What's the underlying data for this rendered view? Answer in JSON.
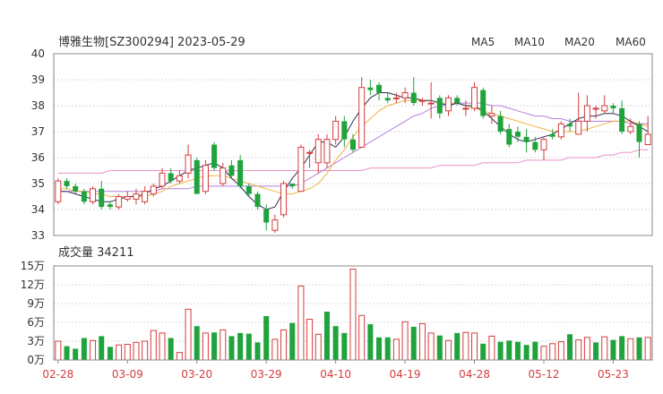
{
  "header": {
    "title": "博雅生物[SZ300294] 2023-05-29"
  },
  "legend": [
    {
      "label": "MA5",
      "color": "#2b2d57"
    },
    {
      "label": "MA10",
      "color": "#f2b142"
    },
    {
      "label": "MA20",
      "color": "#b67ee0"
    },
    {
      "label": "MA60",
      "color": "#ee8fc6"
    }
  ],
  "volume_header": {
    "label": "成交量 34211"
  },
  "colors": {
    "up": "#d43c3c",
    "down": "#1fa33b",
    "grid": "#d9d9d9",
    "frame": "#888888"
  },
  "chart_data": [
    {
      "type": "candlestick",
      "ylim": [
        33,
        40
      ],
      "yticks": [
        "40",
        "39",
        "38",
        "37",
        "36",
        "35",
        "34",
        "33"
      ],
      "xlabels": [
        "02-28",
        "03-09",
        "03-20",
        "03-29",
        "04-10",
        "04-19",
        "04-28",
        "05-12",
        "05-23"
      ],
      "xlabel_index": [
        0,
        8,
        16,
        24,
        32,
        40,
        48,
        56,
        64
      ],
      "candles": [
        [
          34.3,
          35.1,
          35.2,
          34.2
        ],
        [
          35.1,
          34.9,
          35.2,
          34.8
        ],
        [
          34.9,
          34.7,
          35.0,
          34.6
        ],
        [
          34.7,
          34.3,
          34.8,
          34.2
        ],
        [
          34.3,
          34.8,
          34.9,
          34.2
        ],
        [
          34.8,
          34.1,
          35.1,
          34.0
        ],
        [
          34.2,
          34.1,
          34.3,
          34.0
        ],
        [
          34.1,
          34.5,
          34.6,
          34.0
        ],
        [
          34.4,
          34.5,
          34.7,
          34.3
        ],
        [
          34.4,
          34.6,
          34.8,
          34.2
        ],
        [
          34.3,
          34.7,
          34.9,
          34.2
        ],
        [
          34.6,
          34.9,
          35.0,
          34.5
        ],
        [
          34.9,
          35.4,
          35.6,
          34.8
        ],
        [
          35.4,
          35.1,
          35.6,
          35.0
        ],
        [
          35.1,
          35.3,
          35.5,
          35.0
        ],
        [
          35.4,
          36.1,
          36.5,
          35.2
        ],
        [
          35.9,
          34.6,
          36.0,
          34.6
        ],
        [
          34.7,
          35.7,
          35.9,
          34.6
        ],
        [
          36.5,
          35.6,
          36.6,
          35.5
        ],
        [
          35.0,
          35.6,
          35.8,
          34.9
        ],
        [
          35.7,
          35.3,
          35.9,
          35.2
        ],
        [
          35.9,
          34.9,
          36.1,
          34.8
        ],
        [
          34.9,
          34.6,
          35.0,
          34.5
        ],
        [
          34.6,
          34.1,
          34.7,
          34.0
        ],
        [
          34.0,
          33.5,
          34.2,
          33.2
        ],
        [
          33.2,
          33.6,
          33.8,
          33.1
        ],
        [
          33.8,
          35.0,
          35.1,
          33.7
        ],
        [
          35.0,
          34.9,
          35.0,
          34.8
        ],
        [
          34.7,
          36.4,
          36.5,
          34.7
        ],
        [
          36.2,
          36.2,
          36.3,
          35.6
        ],
        [
          35.8,
          36.7,
          36.9,
          35.4
        ],
        [
          35.8,
          36.7,
          36.9,
          35.6
        ],
        [
          36.7,
          37.4,
          37.6,
          36.5
        ],
        [
          37.4,
          36.7,
          37.6,
          36.4
        ],
        [
          36.7,
          36.3,
          36.9,
          36.2
        ],
        [
          36.4,
          38.7,
          39.1,
          36.4
        ],
        [
          38.7,
          38.6,
          39.0,
          38.4
        ],
        [
          38.8,
          38.5,
          38.9,
          38.2
        ],
        [
          38.3,
          38.2,
          38.5,
          38.1
        ],
        [
          38.3,
          38.3,
          38.5,
          38.1
        ],
        [
          38.3,
          38.5,
          38.7,
          38.1
        ],
        [
          38.5,
          38.1,
          39.1,
          38.0
        ],
        [
          38.2,
          38.2,
          38.3,
          38.0
        ],
        [
          38.1,
          38.1,
          38.9,
          37.5
        ],
        [
          38.3,
          37.7,
          38.4,
          37.5
        ],
        [
          37.8,
          38.3,
          38.4,
          37.6
        ],
        [
          38.3,
          38.1,
          38.4,
          38.0
        ],
        [
          37.9,
          37.9,
          38.2,
          37.6
        ],
        [
          37.9,
          38.7,
          38.9,
          37.8
        ],
        [
          38.6,
          37.6,
          38.7,
          37.5
        ],
        [
          37.6,
          37.7,
          38.0,
          37.3
        ],
        [
          37.6,
          37.0,
          37.8,
          36.9
        ],
        [
          37.1,
          36.5,
          37.3,
          36.4
        ],
        [
          37.0,
          36.8,
          37.2,
          36.6
        ],
        [
          36.8,
          36.6,
          37.1,
          36.2
        ],
        [
          36.6,
          36.3,
          36.8,
          36.2
        ],
        [
          36.3,
          36.7,
          36.8,
          35.9
        ],
        [
          36.9,
          36.8,
          37.1,
          36.7
        ],
        [
          36.8,
          37.3,
          37.4,
          36.7
        ],
        [
          37.3,
          37.2,
          37.5,
          37.0
        ],
        [
          36.9,
          37.4,
          38.5,
          36.9
        ],
        [
          37.4,
          38.0,
          38.4,
          37.0
        ],
        [
          37.9,
          37.9,
          38.0,
          37.5
        ],
        [
          37.8,
          38.0,
          38.4,
          37.7
        ],
        [
          38.0,
          37.9,
          38.1,
          37.7
        ],
        [
          37.9,
          37.0,
          38.2,
          36.9
        ],
        [
          37.0,
          37.2,
          37.5,
          36.9
        ],
        [
          37.3,
          36.6,
          37.4,
          36.0
        ],
        [
          36.5,
          36.9,
          37.6,
          36.5
        ]
      ],
      "ma5": [
        34.7,
        34.7,
        34.6,
        34.5,
        34.4,
        34.3,
        34.3,
        34.4,
        34.5,
        34.5,
        34.6,
        34.8,
        34.9,
        35.1,
        35.3,
        35.5,
        35.6,
        35.7,
        35.8,
        35.6,
        35.2,
        34.9,
        34.5,
        34.2,
        34.0,
        34.1,
        34.7,
        35.2,
        35.6,
        36.1,
        36.6,
        36.6,
        36.4,
        36.8,
        37.4,
        37.9,
        38.3,
        38.5,
        38.5,
        38.4,
        38.3,
        38.3,
        38.2,
        38.2,
        38.1,
        38.0,
        38.1,
        38.0,
        38.0,
        37.8,
        37.5,
        37.2,
        36.9,
        36.7,
        36.6,
        36.7,
        36.8,
        36.9,
        37.1,
        37.3,
        37.5,
        37.6,
        37.6,
        37.7,
        37.7,
        37.6,
        37.4,
        37.2,
        37.0
      ],
      "ma10": [
        34.8,
        34.8,
        34.7,
        34.7,
        34.6,
        34.6,
        34.5,
        34.5,
        34.5,
        34.5,
        34.5,
        34.6,
        34.7,
        34.9,
        35.0,
        35.1,
        35.2,
        35.3,
        35.3,
        35.3,
        35.2,
        35.1,
        35.0,
        34.9,
        34.8,
        34.7,
        34.6,
        34.6,
        34.7,
        34.8,
        35.0,
        35.4,
        35.9,
        36.3,
        36.8,
        37.2,
        37.5,
        37.8,
        38.0,
        38.1,
        38.2,
        38.2,
        38.2,
        38.2,
        38.1,
        38.1,
        38.1,
        38.0,
        37.9,
        37.8,
        37.7,
        37.6,
        37.5,
        37.4,
        37.3,
        37.2,
        37.1,
        37.0,
        37.0,
        37.0,
        37.0,
        37.1,
        37.2,
        37.3,
        37.4,
        37.4,
        37.4,
        37.3,
        37.2
      ],
      "ma20": [
        34.7,
        34.7,
        34.7,
        34.7,
        34.7,
        34.7,
        34.7,
        34.7,
        34.7,
        34.7,
        34.7,
        34.7,
        34.8,
        34.8,
        34.8,
        34.8,
        34.9,
        34.9,
        34.9,
        34.9,
        34.9,
        34.9,
        34.9,
        34.9,
        34.9,
        34.9,
        34.9,
        34.9,
        35.0,
        35.2,
        35.4,
        35.6,
        35.8,
        36.0,
        36.2,
        36.4,
        36.6,
        36.8,
        37.0,
        37.2,
        37.4,
        37.6,
        37.7,
        37.9,
        38.0,
        38.0,
        38.1,
        38.1,
        38.1,
        38.1,
        38.0,
        38.0,
        37.9,
        37.8,
        37.7,
        37.6,
        37.6,
        37.5,
        37.5,
        37.4,
        37.4,
        37.4,
        37.4,
        37.4,
        37.4,
        37.4,
        37.3,
        37.3,
        37.3
      ],
      "ma60": [
        35.4,
        35.4,
        35.4,
        35.4,
        35.4,
        35.4,
        35.5,
        35.5,
        35.5,
        35.5,
        35.5,
        35.5,
        35.5,
        35.5,
        35.5,
        35.5,
        35.5,
        35.5,
        35.5,
        35.5,
        35.5,
        35.5,
        35.5,
        35.5,
        35.5,
        35.5,
        35.5,
        35.5,
        35.5,
        35.5,
        35.5,
        35.5,
        35.5,
        35.5,
        35.5,
        35.5,
        35.6,
        35.6,
        35.6,
        35.6,
        35.6,
        35.6,
        35.6,
        35.6,
        35.7,
        35.7,
        35.7,
        35.7,
        35.7,
        35.8,
        35.8,
        35.8,
        35.8,
        35.8,
        35.9,
        35.9,
        35.9,
        35.9,
        35.9,
        36.0,
        36.0,
        36.0,
        36.0,
        36.1,
        36.1,
        36.2,
        36.2,
        36.3,
        36.3
      ]
    },
    {
      "type": "bar",
      "unit": "万",
      "ylim": [
        0,
        15
      ],
      "yticks": [
        "15万",
        "12万",
        "9万",
        "6万",
        "3万",
        "0万"
      ],
      "values": [
        3.0,
        2.2,
        1.8,
        3.5,
        3.1,
        3.8,
        2.1,
        2.4,
        2.5,
        2.8,
        3.0,
        4.7,
        4.3,
        3.5,
        1.2,
        8.1,
        5.4,
        4.3,
        4.4,
        4.8,
        3.8,
        4.3,
        4.2,
        2.8,
        7.0,
        3.3,
        4.8,
        5.9,
        11.8,
        6.5,
        4.1,
        7.7,
        5.4,
        4.3,
        14.5,
        7.1,
        5.7,
        3.6,
        3.6,
        3.3,
        6.1,
        5.3,
        5.8,
        4.3,
        3.9,
        3.1,
        4.3,
        4.4,
        4.3,
        2.6,
        3.8,
        2.9,
        3.1,
        2.9,
        2.4,
        2.9,
        2.2,
        2.6,
        2.9,
        4.1,
        3.2,
        3.6,
        2.8,
        3.7,
        3.2,
        3.8,
        3.4,
        3.6,
        3.6
      ],
      "up": [
        true,
        false,
        false,
        false,
        true,
        false,
        false,
        true,
        true,
        true,
        true,
        true,
        true,
        false,
        true,
        true,
        false,
        true,
        false,
        true,
        false,
        false,
        false,
        false,
        false,
        true,
        true,
        false,
        true,
        true,
        true,
        false,
        false,
        false,
        true,
        true,
        false,
        false,
        false,
        true,
        true,
        false,
        true,
        true,
        false,
        true,
        false,
        true,
        true,
        false,
        true,
        false,
        false,
        false,
        false,
        false,
        true,
        true,
        true,
        false,
        true,
        true,
        false,
        true,
        false,
        false,
        true,
        false,
        true
      ]
    }
  ]
}
